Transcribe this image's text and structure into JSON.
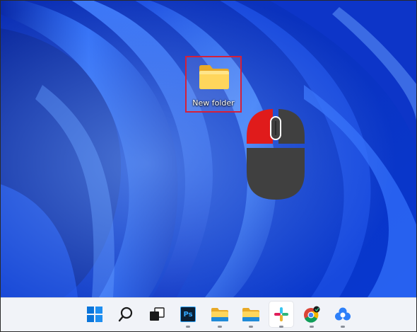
{
  "desktop": {
    "icons": [
      {
        "label": "New folder",
        "icon": "folder-icon",
        "selected": true
      }
    ],
    "highlight_color": "#d4203a",
    "wallpaper": "windows-11-bloom-blue"
  },
  "overlay": {
    "mouse_illustration": "mouse-right-click-icon",
    "highlighted_button": "right",
    "highlight_color": "#e01b1b",
    "body_color": "#404040"
  },
  "taskbar": {
    "apps": [
      {
        "icon": "windows-start-icon",
        "running": false
      },
      {
        "icon": "search-icon",
        "running": false
      },
      {
        "icon": "task-view-icon",
        "running": false
      },
      {
        "icon": "photoshop-icon",
        "label": "Ps",
        "running": true
      },
      {
        "icon": "file-explorer-icon",
        "running": true
      },
      {
        "icon": "file-explorer-icon",
        "running": true
      },
      {
        "icon": "slack-icon",
        "running": true,
        "active": true
      },
      {
        "icon": "chrome-icon",
        "running": true
      },
      {
        "icon": "app-icon",
        "running": true
      }
    ],
    "background": "#f1f3f8"
  }
}
